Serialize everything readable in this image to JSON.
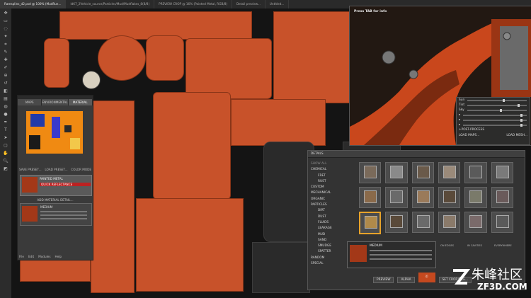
{
  "tabs": [
    {
      "label": "Ramsplins_d2.psd @ 100% (MudRun..."
    },
    {
      "label": "ld67_2Vehicle_source/Particles/Mud/Mudflakes_8(8/8)"
    },
    {
      "label": "PREVIEW CROP @ 16% (Painted Metal, RGB/8)"
    },
    {
      "label": "Detail preview..."
    },
    {
      "label": "Untitled..."
    }
  ],
  "preview": {
    "tip": "Press TAB for info"
  },
  "light_panel": {
    "sun": "Sun",
    "tint": "Tint",
    "sky": "Sky",
    "post_process": "POST-PROCESS",
    "load_maps": "LOAD MAPS...",
    "load_mesh": "LOAD MESH..."
  },
  "material_panel": {
    "tabs": [
      "MAPS",
      "ENVIRONMENTAL",
      "MATERIAL"
    ],
    "save_preset": "SAVE PRESET...",
    "load_preset": "LOAD PRESET...",
    "color_mode": "COLOR MODE",
    "painted_metal": "PAINTED METAL",
    "quick_reflectance": "QUICK REFLECTANCE",
    "add_material_detail": "ADD MATERIAL DETAIL...",
    "medium": "MEDIUM",
    "footer": [
      "File",
      "Edit",
      "Modules",
      "Help"
    ]
  },
  "details": {
    "title": "DETAILS",
    "categories": [
      {
        "label": "SHOW ALL",
        "sub": false,
        "dim": true
      },
      {
        "label": "CHEMICAL",
        "sub": false,
        "dim": false,
        "arrow": "▸"
      },
      {
        "label": "FRET",
        "sub": true,
        "dim": false
      },
      {
        "label": "RUST",
        "sub": true,
        "dim": false
      },
      {
        "label": "CUSTOM",
        "sub": false,
        "dim": false,
        "arrow": "▸"
      },
      {
        "label": "MECHANICAL",
        "sub": false,
        "dim": false,
        "arrow": "▸"
      },
      {
        "label": "ORGANIC",
        "sub": false,
        "dim": false
      },
      {
        "label": "PARTICLES",
        "sub": false,
        "dim": false,
        "arrow": "▸"
      },
      {
        "label": "DIRT",
        "sub": true,
        "dim": false
      },
      {
        "label": "DUST",
        "sub": true,
        "dim": false
      },
      {
        "label": "FLUIDS",
        "sub": true,
        "dim": false,
        "arrow": "▸"
      },
      {
        "label": "LEAKAGE",
        "sub": true,
        "dim": false
      },
      {
        "label": "MUD",
        "sub": true,
        "dim": false
      },
      {
        "label": "SAND",
        "sub": true,
        "dim": false
      },
      {
        "label": "SMUDGE",
        "sub": true,
        "dim": false
      },
      {
        "label": "SPATTER",
        "sub": true,
        "dim": false
      },
      {
        "label": "RANDOM",
        "sub": false,
        "dim": false
      },
      {
        "label": "SPECIAL",
        "sub": false,
        "dim": false
      }
    ],
    "medium": "MEDIUM",
    "options": {
      "on_edges": "ON EDGES",
      "in_cavities": "IN CAVITIES",
      "everywhere": "EVERYWHERE"
    },
    "preview_label": "PREVIEW",
    "alpha_label": "ALPHA",
    "set_crop": "SET CROP SIZE..."
  },
  "watermark": {
    "cn": "朱峰社区",
    "en": "ZF3D.COM"
  }
}
